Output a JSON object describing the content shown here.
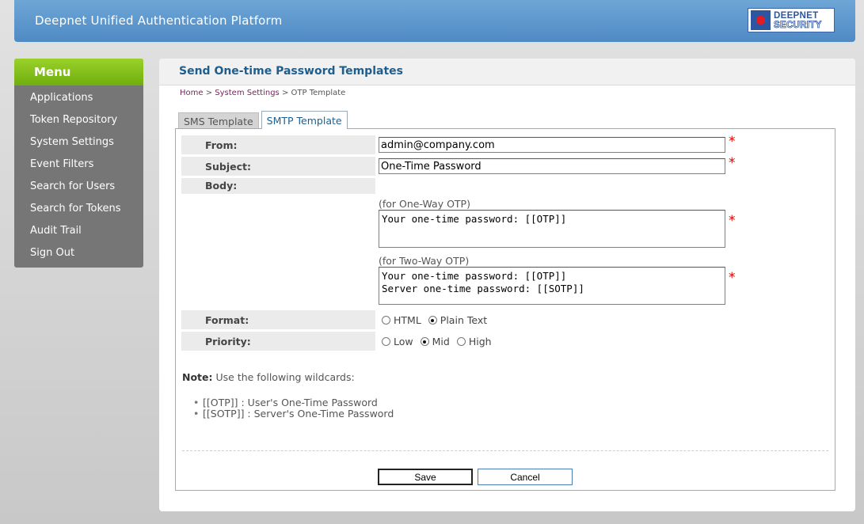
{
  "header": {
    "title": "Deepnet Unified Authentication Platform",
    "logo_line1": "DEEPNET",
    "logo_line2": "SECURITY"
  },
  "menu": {
    "title": "Menu",
    "items": [
      "Applications",
      "Token Repository",
      "System Settings",
      "Event Filters",
      "Search for Users",
      "Search for Tokens",
      "Audit Trail",
      "Sign Out"
    ]
  },
  "page": {
    "title": "Send One-time Password Templates",
    "breadcrumb": {
      "home": "Home",
      "sep1": " > ",
      "settings": "System Settings",
      "sep2": " > ",
      "current": "OTP Template"
    }
  },
  "tabs": {
    "sms": "SMS Template",
    "smtp": "SMTP Template",
    "active": "smtp"
  },
  "form": {
    "from_label": "From:",
    "from_value": "admin@company.com",
    "subject_label": "Subject:",
    "subject_value": "One-Time Password",
    "body_label": "Body:",
    "oneway_hint": "(for One-Way OTP)",
    "oneway_value": "Your one-time password: [[OTP]]",
    "twoway_hint": "(for Two-Way OTP)",
    "twoway_value": "Your one-time password: [[OTP]]\nServer one-time password: [[SOTP]]",
    "required_mark": "*",
    "format_label": "Format:",
    "format_options": [
      "HTML",
      "Plain Text"
    ],
    "format_selected": "Plain Text",
    "priority_label": "Priority:",
    "priority_options": [
      "Low",
      "Mid",
      "High"
    ],
    "priority_selected": "Mid"
  },
  "note": {
    "label": "Note:",
    "text": " Use the following wildcards:",
    "items": [
      "[[OTP]] : User's One-Time Password",
      "[[SOTP]] : Server's One-Time Password"
    ]
  },
  "buttons": {
    "save": "Save",
    "cancel": "Cancel"
  },
  "colors": {
    "header_blue": "#5b93cc",
    "menu_green": "#86c11c",
    "title_blue": "#1e5e8e",
    "required_red": "#dd0000"
  }
}
